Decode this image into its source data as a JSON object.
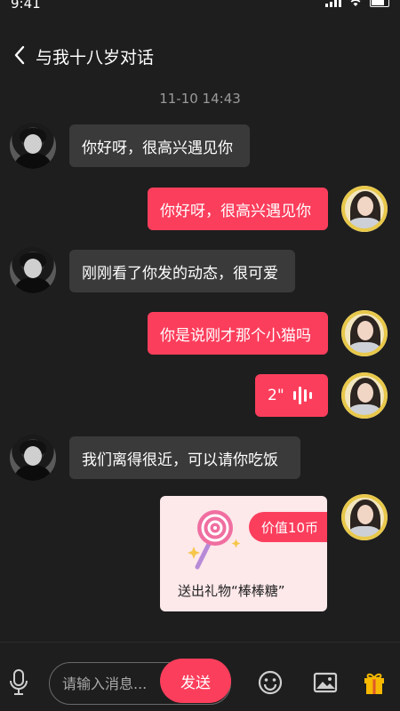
{
  "status_bar": {
    "time": "9:41"
  },
  "header": {
    "title": "与我十八岁对话"
  },
  "timestamp": "11-10  14:43",
  "messages": [
    {
      "side": "in",
      "text": "你好呀，很高兴遇见你"
    },
    {
      "side": "out",
      "text": "你好呀，很高兴遇见你"
    },
    {
      "side": "in",
      "text": "刚刚看了你发的动态，很可爱"
    },
    {
      "side": "out",
      "text": "你是说刚才那个小猫吗"
    },
    {
      "side": "out",
      "type": "voice",
      "duration": "2\""
    },
    {
      "side": "in",
      "text": "我们离得很近，可以请你吃饭"
    }
  ],
  "gift": {
    "price": "价值10币",
    "text": "送出礼物“棒棒糖”"
  },
  "composer": {
    "placeholder": "请输入消息...",
    "send_label": "发送"
  },
  "colors": {
    "accent": "#fb3e5c",
    "background": "#1e1e1e",
    "incoming_bubble": "#3a3a3a",
    "timestamp": "#9a9a9a"
  },
  "icons": [
    "back-icon",
    "mic-icon",
    "emoji-icon",
    "image-icon",
    "gift-icon"
  ]
}
